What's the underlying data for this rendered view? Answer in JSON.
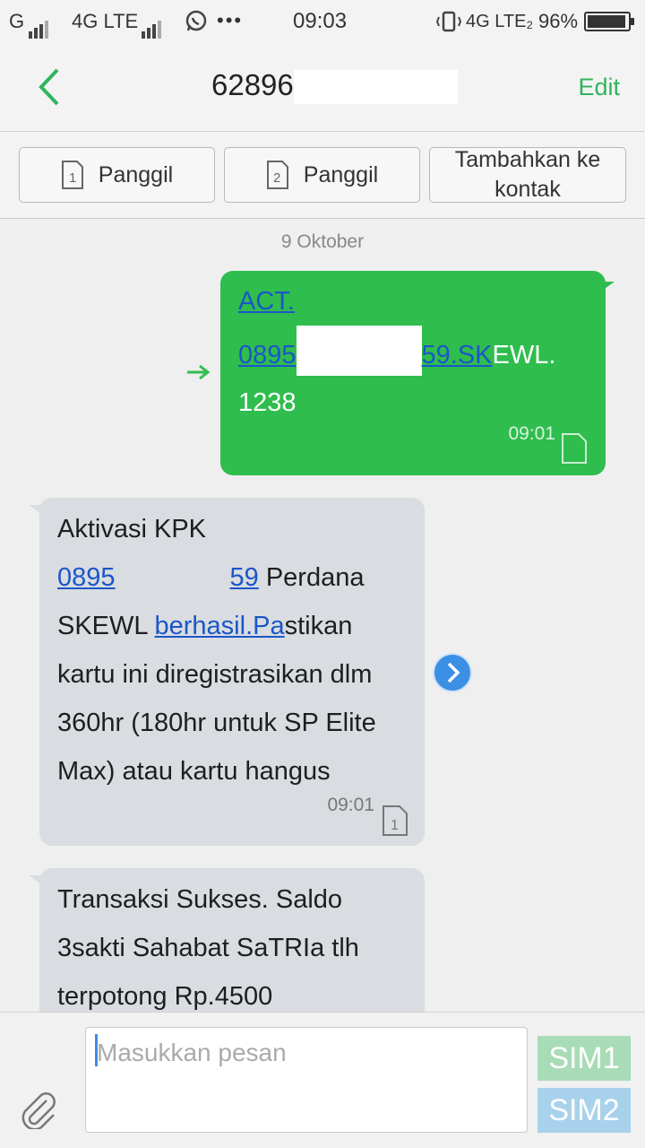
{
  "status_bar": {
    "sim1_label": "G",
    "network1": "4G LTE",
    "time": "09:03",
    "network2": "4G LTE₂",
    "battery": "96%",
    "battery_level": 0.96
  },
  "header": {
    "contact_number": "62896",
    "edit_label": "Edit"
  },
  "actions": [
    {
      "sim": "1",
      "label": "Panggil"
    },
    {
      "sim": "2",
      "label": "Panggil"
    },
    {
      "label": "Tambahkan ke kontak"
    }
  ],
  "conversation": {
    "date": "9 Oktober",
    "messages": [
      {
        "direction": "outgoing",
        "line1": "ACT.",
        "line2_link_prefix": "0895",
        "line2_link_suffix": "59.SK",
        "line2_rest": "EWL.",
        "line3": "1238",
        "time": "09:01"
      },
      {
        "direction": "incoming",
        "line1": "Aktivasi KPK",
        "link_number_prefix": "0895",
        "link_number_suffix": "59",
        "after_number": " Perdana",
        "before_link2": "SKEWL ",
        "link2": "berhasil.Pa",
        "after_link2": "stikan",
        "line4": "kartu ini diregistrasikan dlm",
        "line5": "360hr (180hr untuk SP Elite",
        "line6": "Max) atau kartu hangus",
        "time": "09:01",
        "sim": "1"
      },
      {
        "direction": "incoming",
        "line1": "Transaksi Sukses. Saldo",
        "line2": "3sakti Sahabat SaTRIa tlh",
        "line3": "terpotong Rp.4500"
      }
    ]
  },
  "composer": {
    "placeholder": "Masukkan pesan",
    "sim1_label": "SIM1",
    "sim2_label": "SIM2"
  },
  "colors": {
    "accent_green": "#2fbd4d",
    "link_blue": "#1b56c9",
    "sim1_button": "#a8dcb6",
    "sim2_button": "#a8d2ec"
  }
}
